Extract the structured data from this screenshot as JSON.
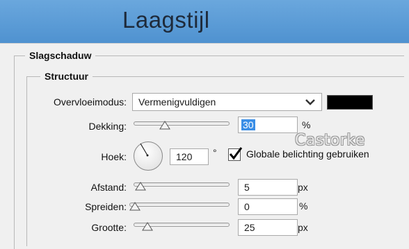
{
  "window": {
    "title": "Laagstijl"
  },
  "sections": {
    "outer": "Slagschaduw",
    "inner": "Structuur"
  },
  "blend": {
    "label": "Overvloeimodus:",
    "value": "Vermenigvuldigen",
    "color": "#000000"
  },
  "opacity": {
    "label": "Dekking:",
    "value": "30",
    "unit": "%",
    "slider_percent": 30
  },
  "angle": {
    "label": "Hoek:",
    "value": "120",
    "unit": "°",
    "global_light_label": "Globale belichting gebruiken",
    "global_light_checked": true
  },
  "distance": {
    "label": "Afstand:",
    "value": "5",
    "unit": "px",
    "slider_percent": 2
  },
  "spread": {
    "label": "Spreiden:",
    "value": "0",
    "unit": "%",
    "slider_percent": 0
  },
  "size": {
    "label": "Grootte:",
    "value": "25",
    "unit": "px",
    "slider_percent": 10
  },
  "watermark": "Castorke"
}
